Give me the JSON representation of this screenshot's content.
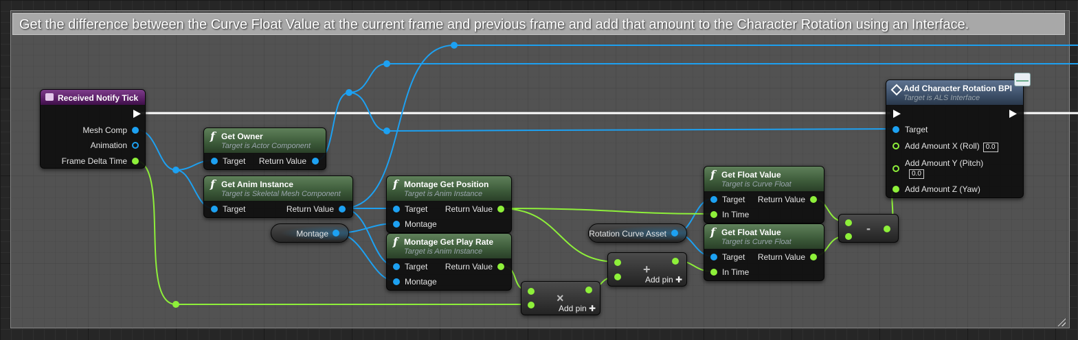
{
  "comment": {
    "text": "Get the difference between the Curve Float Value at the current frame and previous frame and add that amount to the Character Rotation using an Interface."
  },
  "nodes": {
    "received_notify_tick": {
      "title": "Received Notify Tick",
      "pins": {
        "mesh_comp": "Mesh Comp",
        "animation": "Animation",
        "frame_delta_time": "Frame Delta Time"
      }
    },
    "get_owner": {
      "title": "Get Owner",
      "subtitle": "Target is Actor Component",
      "pins": {
        "target": "Target",
        "return_value": "Return Value"
      }
    },
    "get_anim_instance": {
      "title": "Get Anim Instance",
      "subtitle": "Target is Skeletal Mesh Component",
      "pins": {
        "target": "Target",
        "return_value": "Return Value"
      }
    },
    "montage_var": {
      "label": "Montage"
    },
    "montage_get_position": {
      "title": "Montage Get Position",
      "subtitle": "Target is Anim Instance",
      "pins": {
        "target": "Target",
        "return_value": "Return Value",
        "montage": "Montage"
      }
    },
    "montage_get_play_rate": {
      "title": "Montage Get Play Rate",
      "subtitle": "Target is Anim Instance",
      "pins": {
        "target": "Target",
        "return_value": "Return Value",
        "montage": "Montage"
      }
    },
    "multiply": {
      "symbol": "×",
      "add_pin": "Add pin"
    },
    "add": {
      "symbol": "+",
      "add_pin": "Add pin"
    },
    "rotation_curve_asset": {
      "label": "Rotation Curve Asset"
    },
    "get_float_value_1": {
      "title": "Get Float Value",
      "subtitle": "Target is Curve Float",
      "pins": {
        "target": "Target",
        "return_value": "Return Value",
        "in_time": "In Time"
      }
    },
    "get_float_value_2": {
      "title": "Get Float Value",
      "subtitle": "Target is Curve Float",
      "pins": {
        "target": "Target",
        "return_value": "Return Value",
        "in_time": "In Time"
      }
    },
    "subtract": {
      "symbol": "-"
    },
    "add_character_rotation": {
      "title": "Add Character Rotation BPI",
      "subtitle": "Target is ALS Interface",
      "pins": {
        "target": "Target",
        "amount_x": "Add Amount X (Roll)",
        "amount_x_value": "0.0",
        "amount_y": "Add Amount Y (Pitch)",
        "amount_y_value": "0.0",
        "amount_z": "Add Amount Z (Yaw)"
      }
    }
  },
  "colors": {
    "object_pin": "#1da1f2",
    "float_pin": "#8ef03a",
    "exec_wire": "#ffffff",
    "event_header": "#7d3c8a",
    "function_header": "#3c5a39",
    "interface_header": "#3d5069"
  },
  "icons": {
    "function": "function-f-icon",
    "event": "event-icon",
    "interface": "interface-diamond-icon",
    "message": "envelope-icon",
    "add_pin": "plus-icon"
  }
}
